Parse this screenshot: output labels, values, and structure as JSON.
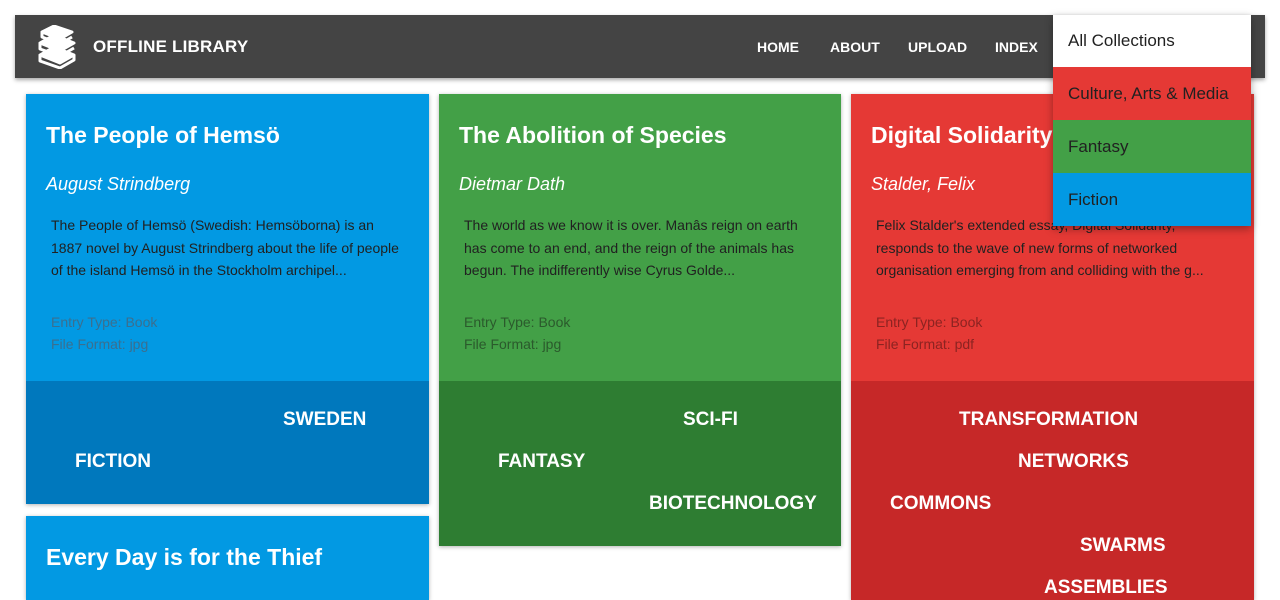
{
  "colors": {
    "navbar": "#444444",
    "blue": "#0299e3",
    "blue_dark": "#0078bd",
    "green": "#43a047",
    "green_dark": "#2e7d32",
    "red": "#e53935",
    "red_dark": "#c62828",
    "dark_text": "#212121",
    "meta_blue": "#3b6f8f",
    "meta_green": "#2b5a2c",
    "meta_red": "#8c2321"
  },
  "navbar": {
    "brand": "OFFLINE LIBRARY",
    "logo_icon": "books-icon",
    "links": [
      "HOME",
      "ABOUT",
      "UPLOAD",
      "INDEX"
    ]
  },
  "dropdown": {
    "items": [
      "All Collections",
      "Culture, Arts & Media",
      "Fantasy",
      "Fiction"
    ]
  },
  "cards": [
    {
      "title": "The People of Hemsö",
      "author": "August Strindberg",
      "description": "The People of Hemsö (Swedish: Hemsöborna) is an 1887 novel by August Strindberg about the life of people of the island Hemsö in the Stockholm archipel...",
      "entry_type": "Entry Type: Book",
      "file_format": "File Format: jpg",
      "tags": [
        "SWEDEN",
        "FICTION"
      ]
    },
    {
      "title": "The Abolition of Species",
      "author": "Dietmar Dath",
      "description": "The world as we know it is over. Manâs reign on earth has come to an end, and the reign of the animals has begun. The indifferently wise Cyrus Golde...",
      "entry_type": "Entry Type: Book",
      "file_format": "File Format: jpg",
      "tags": [
        "SCI-FI",
        "FANTASY",
        "BIOTECHNOLOGY"
      ]
    },
    {
      "title": "Digital Solidarity",
      "author": "Stalder, Felix",
      "description": "Felix Stalder's extended essay, Digital Solidarity, responds to the wave of new forms of networked organisation emerging from and colliding with the g...",
      "entry_type": "Entry Type: Book",
      "file_format": "File Format: pdf",
      "tags": [
        "TRANSFORMATION",
        "NETWORKS",
        "COMMONS",
        "SWARMS",
        "ASSEMBLIES"
      ]
    },
    {
      "title": "Every Day is for the Thief"
    }
  ]
}
